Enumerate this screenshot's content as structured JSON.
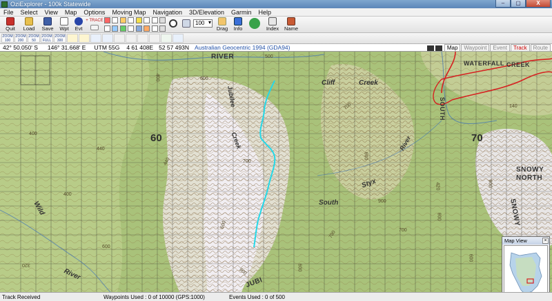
{
  "window": {
    "title": "OziExplorer - 100k Statewide",
    "min_label": "–",
    "max_label": "▢",
    "close_label": "X"
  },
  "menu": [
    "File",
    "Select",
    "View",
    "Map",
    "Options",
    "Moving Map",
    "Navigation",
    "3D/Elevation",
    "Garmin",
    "Help"
  ],
  "toolbar": {
    "quit": "Quit",
    "load": "Load",
    "save": "Save",
    "wpt": "Wpt",
    "evt": "Evt",
    "trace": "+ TRACE",
    "zoom_value": "100",
    "drag": "Drag",
    "info": "Info",
    "index": "Index",
    "name": "Name"
  },
  "zoom_buttons": [
    "ZOOM 100",
    "ZOOM 200",
    "ZOOM 50",
    "ZOOM FULL",
    "ZOOM 300"
  ],
  "status": {
    "lat": "42° 50.050' S",
    "lon": "146° 31.668' E",
    "grid": "UTM 55G",
    "easting": "4 61 408E",
    "northing": "52 57 493N",
    "datum": "Australian Geocentric 1994 (GDA94)"
  },
  "view_tabs": [
    "Map",
    "Waypoint",
    "Event",
    "Track",
    "Route"
  ],
  "map_labels": {
    "grid_60": "60",
    "grid_70": "70",
    "river_top": "RIVER",
    "cliff": "Cliff",
    "creek_top": "Creek",
    "waterfall": "WATERFALL",
    "creek_right": "CREEK",
    "south_vert": "SOUTH",
    "jubilee": "Jubilee",
    "creek_mid": "Creek",
    "styx": "Styx",
    "river_styx": "River",
    "south_mid": "South",
    "snowy": "SNOWY",
    "north": "NORTH",
    "snowy_vert": "SNOWY",
    "wild": "Wild",
    "river_bottom": "River",
    "jub_bottom": "JUBI"
  },
  "contours": [
    "440",
    "400",
    "440",
    "400",
    "600",
    "700",
    "600",
    "420",
    "700",
    "600",
    "700",
    "900",
    "600",
    "600",
    "320",
    "600",
    "900",
    "140",
    "700",
    "900",
    "500",
    "600",
    "400"
  ],
  "map_view": {
    "title": "Map View",
    "close": "×"
  },
  "bottom": {
    "left": "Track Received",
    "waypoints": "Waypoints Used : 0 of 10000  (GPS:1000)",
    "events": "Events Used : 0 of 500"
  },
  "colors": {
    "map_green": "#a9c27a",
    "map_light": "#d8dfb0",
    "contour": "#8a6b3a",
    "track": "#25d8e8",
    "road": "#d62020"
  }
}
